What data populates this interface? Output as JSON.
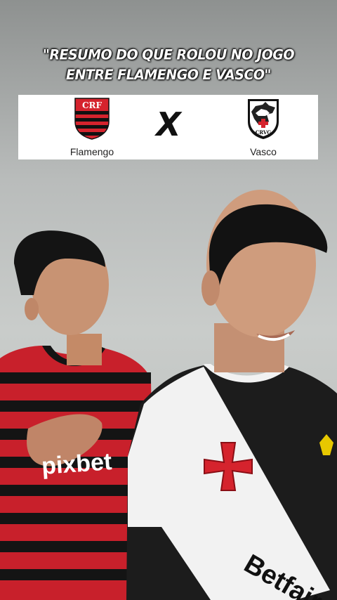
{
  "caption": {
    "line1": "\"RESUMO DO QUE ROLOU NO JOGO",
    "line2": "ENTRE FLAMENGO E VASCO\""
  },
  "match": {
    "home_team": "Flamengo",
    "away_team": "Vasco",
    "versus": "X"
  },
  "jerseys": {
    "home_sponsor": "pixbet",
    "away_sponsor": "Betfair"
  },
  "colors": {
    "flamengo_red": "#d5232d",
    "flamengo_black": "#111111",
    "vasco_black": "#1c1c1c",
    "vasco_white": "#f2f2f2",
    "kappa_yellow": "#e7c800"
  }
}
